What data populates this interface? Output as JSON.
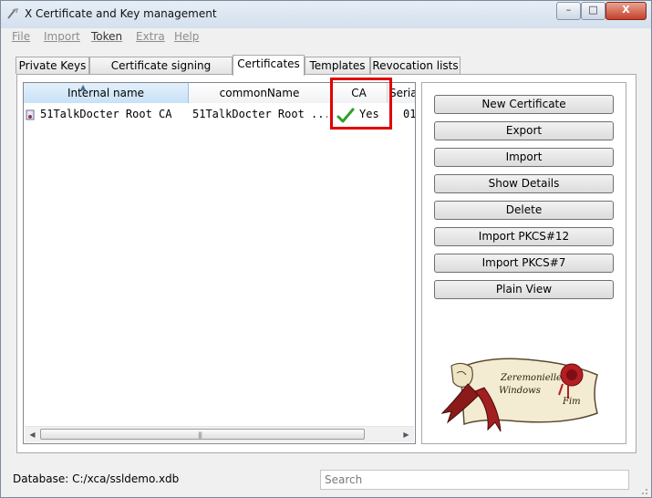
{
  "window": {
    "title": "X Certificate and Key management",
    "controls": {
      "minimize": "–",
      "maximize": "□",
      "close": "X"
    }
  },
  "menu": [
    "File",
    "Import",
    "Token",
    "Extra",
    "Help"
  ],
  "tabs": [
    "Private Keys",
    "Certificate signing requests",
    "Certificates",
    "Templates",
    "Revocation lists"
  ],
  "active_tab": "Certificates",
  "table": {
    "columns": [
      "Internal name",
      "commonName",
      "CA",
      "Serial"
    ],
    "rows": [
      {
        "internal_name": "51TalkDocter Root CA",
        "common_name": "51TalkDocter Root ...",
        "ca": "Yes",
        "serial": "01"
      }
    ],
    "scroll": {
      "left": "◀",
      "right": "▶",
      "grip": "|||"
    }
  },
  "buttons": [
    "New Certificate",
    "Export",
    "Import",
    "Show Details",
    "Delete",
    "Import PKCS#12",
    "Import PKCS#7",
    "Plain View"
  ],
  "logo": {
    "text1": "Zeremonielle",
    "text2": "Windows",
    "text3": "Fim"
  },
  "status": {
    "database": "Database: C:/xca/ssldemo.xdb",
    "search_placeholder": "Search"
  },
  "icons": [
    "app-icon",
    "certificate-row-icon",
    "checkmark-icon",
    "sort-ascending-icon"
  ],
  "colors": {
    "highlight": "#e00000",
    "check": "#2ea02e"
  }
}
